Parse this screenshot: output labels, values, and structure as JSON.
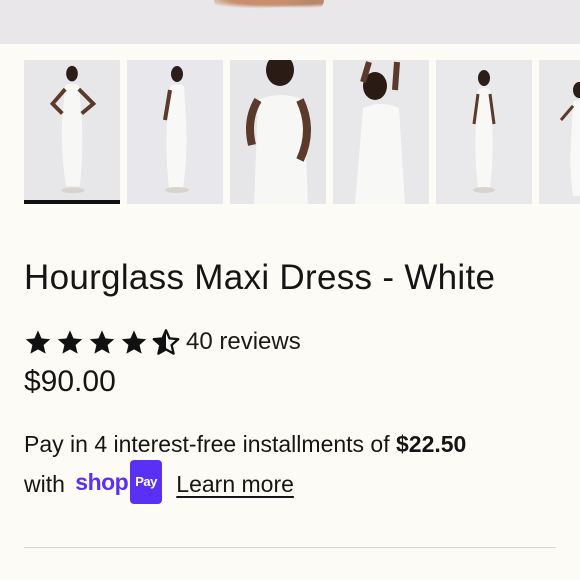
{
  "product": {
    "title": "Hourglass Maxi Dress - White",
    "rating_value": 4.5,
    "rating_max": 5,
    "reviews_label": "40 reviews",
    "price": "$90.00"
  },
  "thumbnails": [
    {
      "alt_icon": "model-standing-hands-on-hips",
      "selected": true
    },
    {
      "alt_icon": "model-side-view"
    },
    {
      "alt_icon": "model-closeup-torso"
    },
    {
      "alt_icon": "model-arms-raised"
    },
    {
      "alt_icon": "model-full-front"
    },
    {
      "alt_icon": "model-partial"
    }
  ],
  "installments": {
    "text": "Pay in 4 interest-free installments of",
    "amount": "$22.50",
    "with_label": "with",
    "shop_logo_text": "shop",
    "pay_badge": "Pay",
    "learn_more": "Learn more"
  },
  "colors": {
    "background": "#fdfbf5",
    "shop_purple": "#5a31f4",
    "text": "#151515"
  }
}
